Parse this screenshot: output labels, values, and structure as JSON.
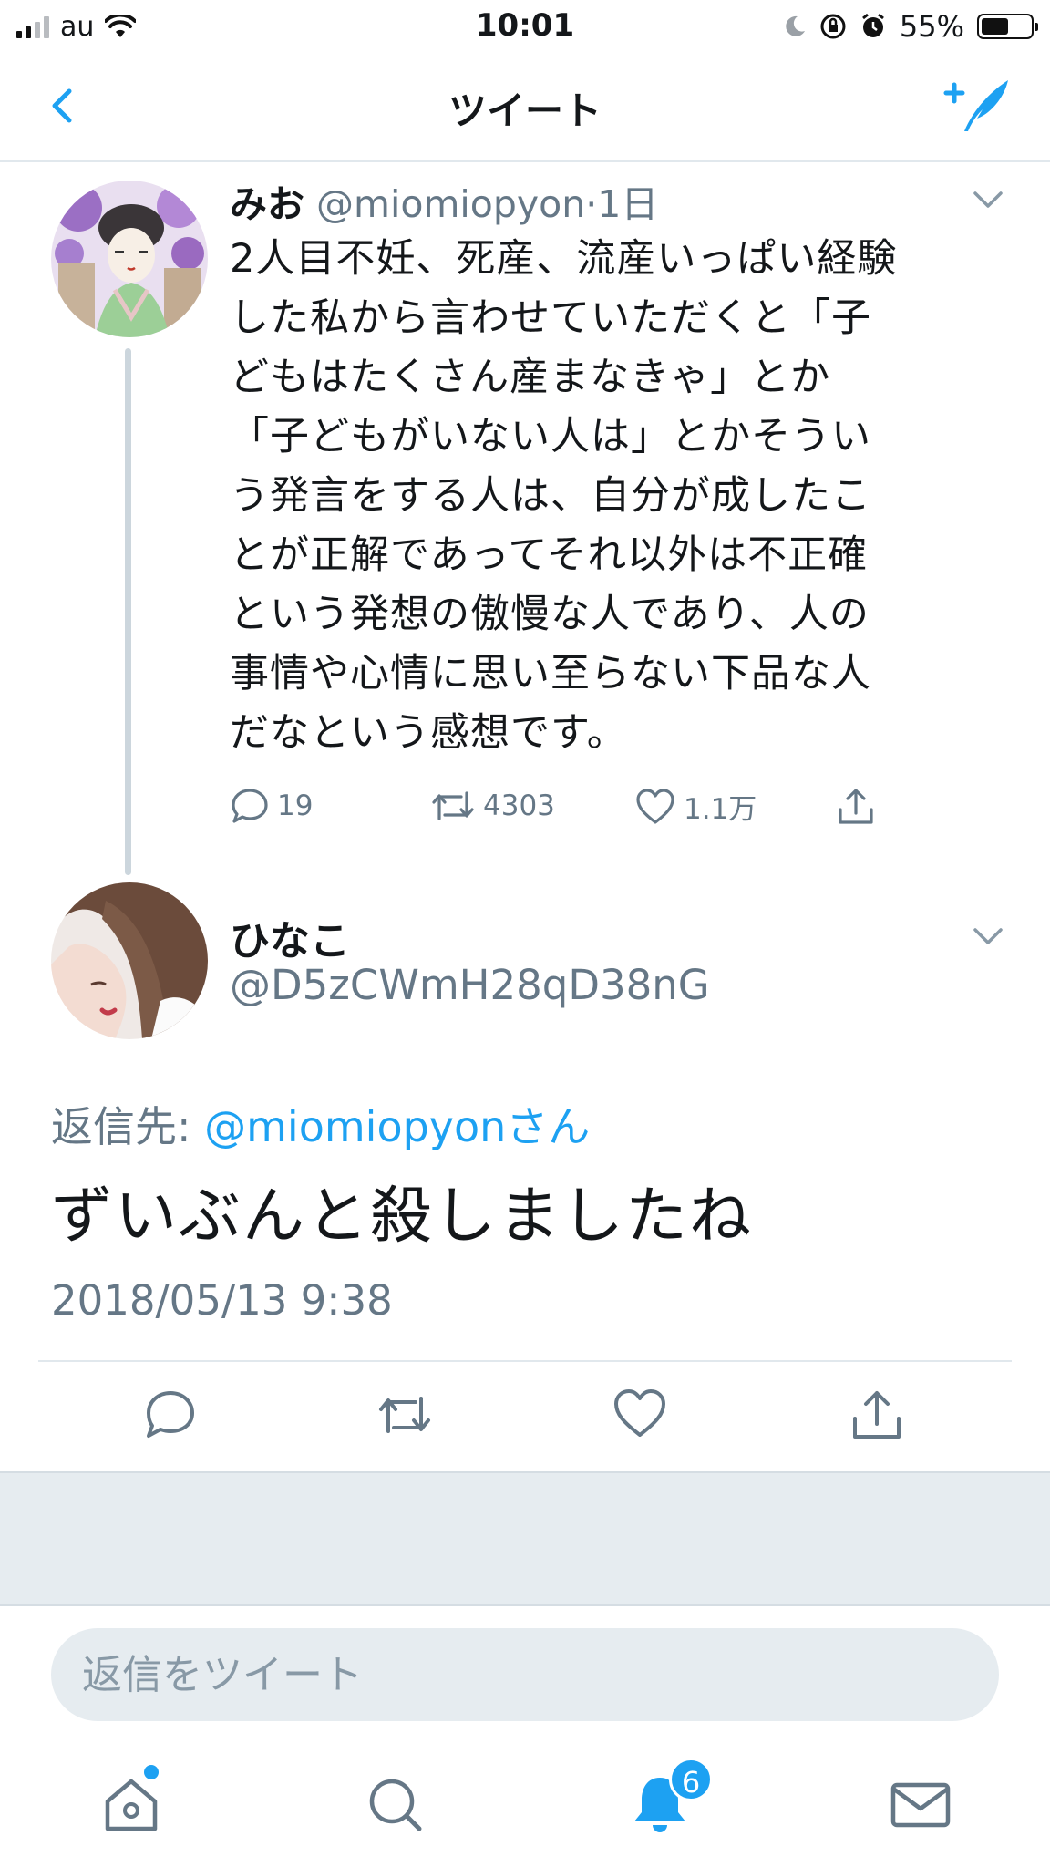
{
  "status_bar": {
    "carrier": "au",
    "time": "10:01",
    "battery_percent_label": "55%",
    "battery_level": 0.55
  },
  "header": {
    "title": "ツイート"
  },
  "parent_tweet": {
    "display_name": "みお",
    "handle": "@miomiopyon",
    "age": "1日",
    "text": "2人目不妊、死産、流産いっぱい経験\nした私から言わせていただくと「子\nどもはたくさん産まなきゃ」とか\n「子どもがいない人は」とかそうい\nう発言をする人は、自分が成したこ\nとが正解であってそれ以外は不正確\nという発想の傲慢な人であり、人の\n事情や心情に思い至らない下品な人\nだなという感想です。",
    "replies": "19",
    "retweets": "4303",
    "likes": "1.1万"
  },
  "focused_tweet": {
    "display_name": "ひなこ",
    "handle": "@D5zCWmH28qD38nG",
    "reply_to_prefix": "返信先: ",
    "reply_to_handle": "@miomiopyonさん",
    "text": "ずいぶんと殺しましたね",
    "timestamp": "2018/05/13 9:38"
  },
  "reply_box": {
    "placeholder": "返信をツイート"
  },
  "tab_bar": {
    "notifications_badge": "6"
  },
  "colors": {
    "accent": "#1da1f2",
    "text_secondary": "#657786",
    "divider": "#e1e8ed"
  }
}
